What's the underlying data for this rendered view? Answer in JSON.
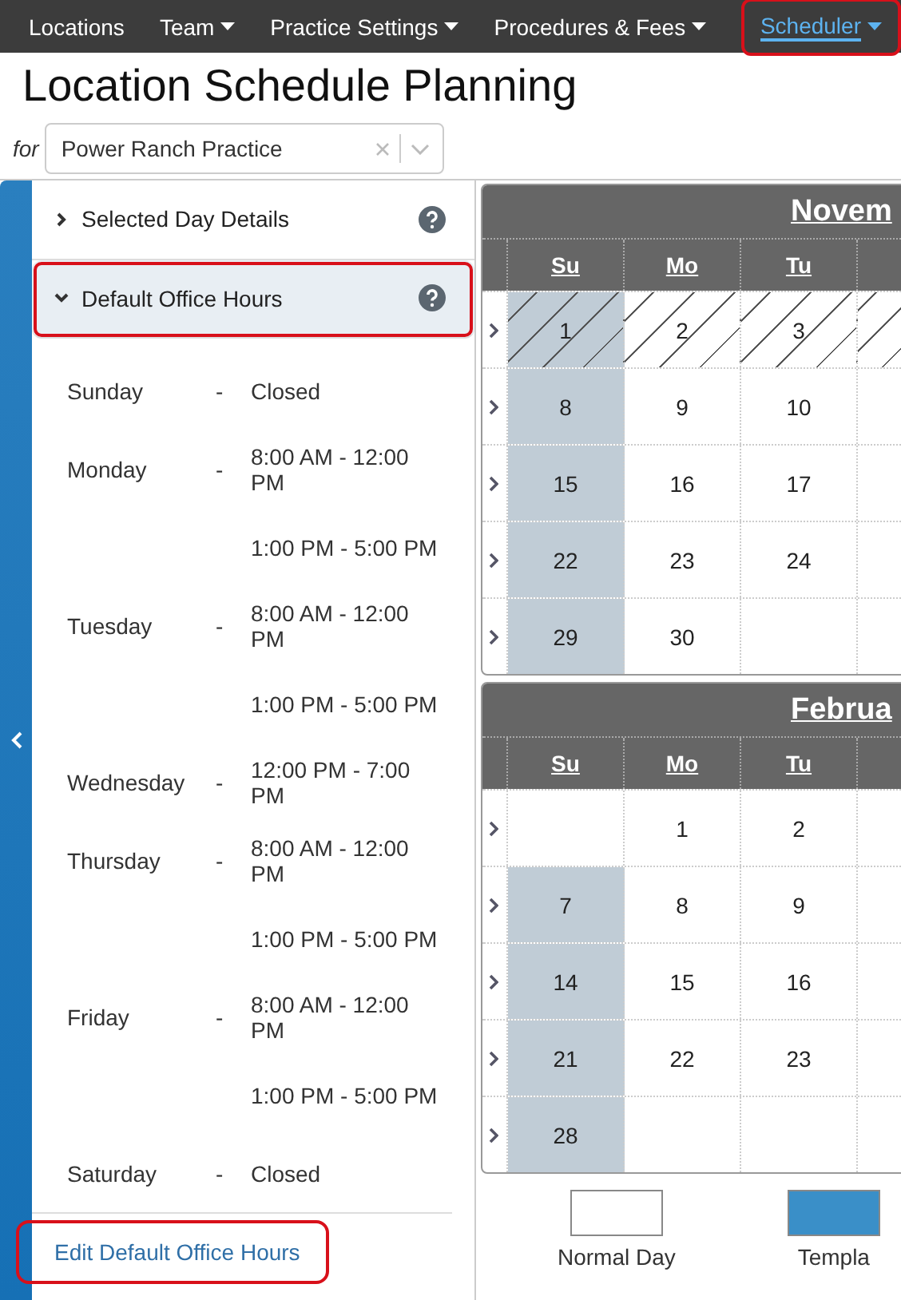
{
  "nav": {
    "items": [
      {
        "label": "Locations",
        "dropdown": false,
        "selected": false,
        "highlighted": false
      },
      {
        "label": "Team",
        "dropdown": true,
        "selected": false,
        "highlighted": false
      },
      {
        "label": "Practice Settings",
        "dropdown": true,
        "selected": false,
        "highlighted": false
      },
      {
        "label": "Procedures & Fees",
        "dropdown": true,
        "selected": false,
        "highlighted": false
      },
      {
        "label": "Scheduler",
        "dropdown": true,
        "selected": true,
        "highlighted": true
      }
    ]
  },
  "title": "Location Schedule Planning",
  "selector": {
    "prefix": "for",
    "value": "Power Ranch Practice"
  },
  "panel": {
    "sections": [
      {
        "title": "Selected Day Details",
        "expanded": false,
        "highlighted": false
      },
      {
        "title": "Default Office Hours",
        "expanded": true,
        "highlighted": true
      }
    ],
    "hours": [
      {
        "day": "Sunday",
        "dash": "-",
        "times": [
          "Closed"
        ]
      },
      {
        "day": "Monday",
        "dash": "-",
        "times": [
          "8:00 AM - 12:00 PM",
          "1:00 PM - 5:00 PM"
        ]
      },
      {
        "day": "Tuesday",
        "dash": "-",
        "times": [
          "8:00 AM - 12:00 PM",
          "1:00 PM - 5:00 PM"
        ]
      },
      {
        "day": "Wednesday",
        "dash": "-",
        "times": [
          "12:00 PM - 7:00 PM"
        ]
      },
      {
        "day": "Thursday",
        "dash": "-",
        "times": [
          "8:00 AM - 12:00 PM",
          "1:00 PM - 5:00 PM"
        ]
      },
      {
        "day": "Friday",
        "dash": "-",
        "times": [
          "8:00 AM - 12:00 PM",
          "1:00 PM - 5:00 PM"
        ]
      },
      {
        "day": "Saturday",
        "dash": "-",
        "times": [
          "Closed"
        ]
      }
    ],
    "edit_link": {
      "label": "Edit Default Office Hours",
      "highlighted": true
    }
  },
  "calendars": [
    {
      "month": "Novem",
      "weekdays": [
        "Su",
        "Mo",
        "Tu"
      ],
      "weeks": [
        {
          "days": [
            {
              "text": "1",
              "shaded": true,
              "hatched": true
            },
            {
              "text": "2",
              "shaded": false,
              "hatched": true
            },
            {
              "text": "3",
              "shaded": false,
              "hatched": true
            }
          ]
        },
        {
          "days": [
            {
              "text": "8",
              "shaded": true,
              "hatched": false
            },
            {
              "text": "9",
              "shaded": false,
              "hatched": false
            },
            {
              "text": "10",
              "shaded": false,
              "hatched": false
            }
          ]
        },
        {
          "days": [
            {
              "text": "15",
              "shaded": true,
              "hatched": false
            },
            {
              "text": "16",
              "shaded": false,
              "hatched": false
            },
            {
              "text": "17",
              "shaded": false,
              "hatched": false
            }
          ]
        },
        {
          "days": [
            {
              "text": "22",
              "shaded": true,
              "hatched": false
            },
            {
              "text": "23",
              "shaded": false,
              "hatched": false
            },
            {
              "text": "24",
              "shaded": false,
              "hatched": false
            }
          ]
        },
        {
          "days": [
            {
              "text": "29",
              "shaded": true,
              "hatched": false
            },
            {
              "text": "30",
              "shaded": false,
              "hatched": false
            },
            {
              "shaded": false,
              "hatched": false
            }
          ]
        }
      ]
    },
    {
      "month": "Februa",
      "weekdays": [
        "Su",
        "Mo",
        "Tu"
      ],
      "weeks": [
        {
          "days": [
            {
              "shaded": false,
              "hatched": false
            },
            {
              "text": "1",
              "shaded": false,
              "hatched": false
            },
            {
              "text": "2",
              "shaded": false,
              "hatched": false
            }
          ]
        },
        {
          "days": [
            {
              "text": "7",
              "shaded": true,
              "hatched": false
            },
            {
              "text": "8",
              "shaded": false,
              "hatched": false
            },
            {
              "text": "9",
              "shaded": false,
              "hatched": false
            }
          ]
        },
        {
          "days": [
            {
              "text": "14",
              "shaded": true,
              "hatched": false
            },
            {
              "text": "15",
              "shaded": false,
              "hatched": false
            },
            {
              "text": "16",
              "shaded": false,
              "hatched": false
            }
          ]
        },
        {
          "days": [
            {
              "text": "21",
              "shaded": true,
              "hatched": false
            },
            {
              "text": "22",
              "shaded": false,
              "hatched": false
            },
            {
              "text": "23",
              "shaded": false,
              "hatched": false
            }
          ]
        },
        {
          "days": [
            {
              "text": "28",
              "shaded": true,
              "hatched": false
            },
            {
              "shaded": false,
              "hatched": false
            },
            {
              "shaded": false,
              "hatched": false
            }
          ]
        }
      ]
    }
  ],
  "legend": [
    {
      "label": "Normal Day",
      "color": "#ffffff"
    },
    {
      "label": "Templa",
      "color": "#3a8fc8"
    }
  ]
}
